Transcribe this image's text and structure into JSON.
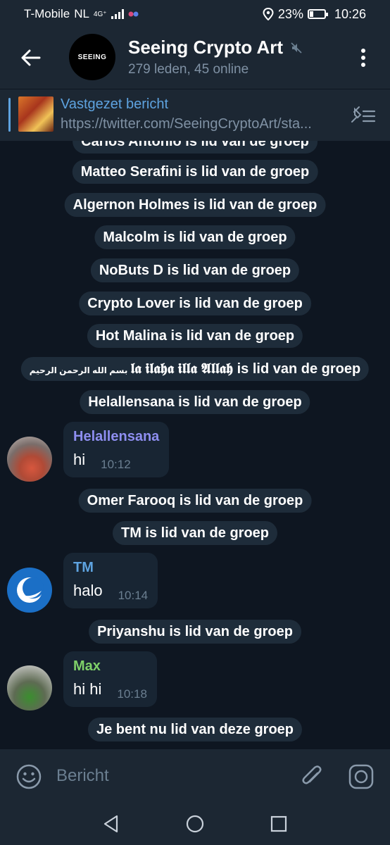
{
  "status_bar": {
    "carrier": "T-Mobile",
    "network": "NL",
    "signal_type": "4G⁺",
    "battery": "23%",
    "battery_level": 0.23,
    "time": "10:26"
  },
  "header": {
    "title": "Seeing Crypto Art",
    "subtitle": "279 leden, 45 online",
    "avatar_text": "SEEING"
  },
  "pinned": {
    "title": "Vastgezet bericht",
    "text": "https://twitter.com/SeeingCryptoArt/sta..."
  },
  "messages": [
    {
      "type": "service",
      "text": "Carlos Antonio is lid van de groep"
    },
    {
      "type": "service",
      "text": "Matteo Serafini is lid van de groep"
    },
    {
      "type": "service",
      "text": "Algernon Holmes is lid van de groep"
    },
    {
      "type": "service",
      "text": "Malcolm is lid van de groep"
    },
    {
      "type": "service",
      "text": "NoButs D is lid van de groep"
    },
    {
      "type": "service",
      "text": "Crypto Lover is lid van de groep"
    },
    {
      "type": "service",
      "text": "Hot Malina is lid van de groep"
    },
    {
      "type": "service",
      "text": "𝖑𝖆 𝖎𝖑𝖆𝖍𝖆 𝖎𝖑𝖑𝖆 𝕬𝖑𝖑𝖆𝖍 is lid van de groep",
      "prefix": "بسم الله الرحمن الرحيم"
    },
    {
      "type": "service",
      "text": "Helallensana is lid van de groep"
    },
    {
      "type": "message",
      "sender": "Helallensana",
      "sender_color": "#8e8ef0",
      "text": "hi",
      "time": "10:12"
    },
    {
      "type": "service",
      "text": "Omer Farooq is lid van de groep"
    },
    {
      "type": "service",
      "text": "TM is lid van de groep"
    },
    {
      "type": "message",
      "sender": "TM",
      "sender_color": "#5ea3e0",
      "text": "halo",
      "time": "10:14"
    },
    {
      "type": "service",
      "text": "Priyanshu is lid van de groep"
    },
    {
      "type": "message",
      "sender": "Max",
      "sender_color": "#7fd069",
      "text": "hi hi",
      "time": "10:18"
    },
    {
      "type": "service",
      "text": "Je bent nu lid van deze groep"
    }
  ],
  "composer": {
    "placeholder": "Bericht"
  },
  "colors": {
    "background": "#0e1621",
    "bar": "#1c2733",
    "accent": "#5ea3e0",
    "bubble": "#182533",
    "service_pill": "#1e2c3a"
  }
}
